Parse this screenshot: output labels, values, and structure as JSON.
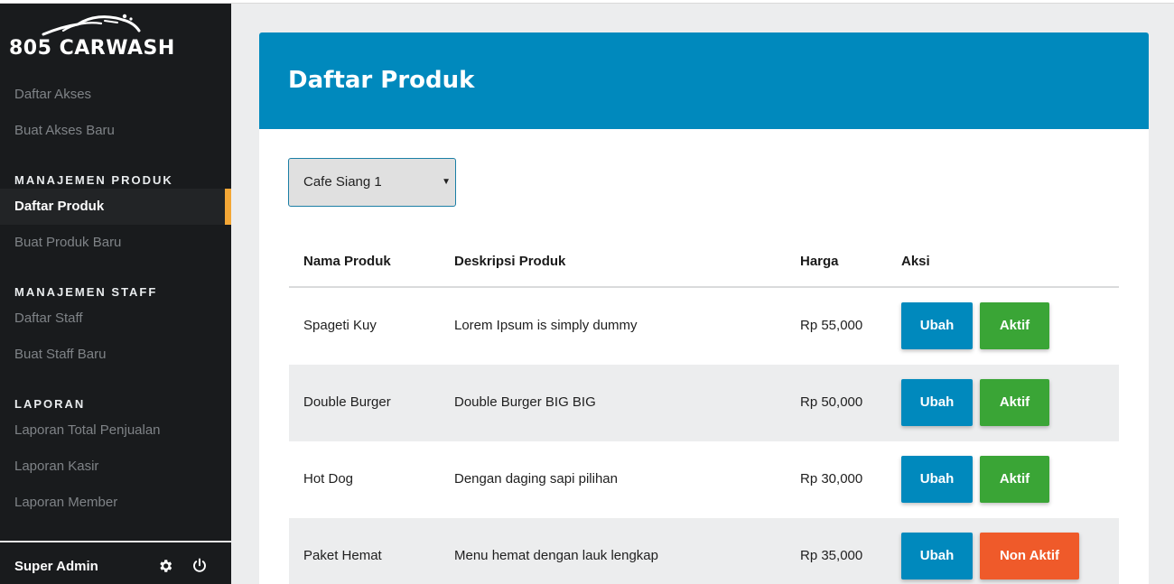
{
  "brand": {
    "name": "805 CARWASH"
  },
  "sidebar": {
    "items_top": [
      {
        "label": "Daftar Akses"
      },
      {
        "label": "Buat Akses Baru"
      }
    ],
    "sections": [
      {
        "title": "MANAJEMEN PRODUK",
        "items": [
          {
            "label": "Daftar Produk",
            "active": true
          },
          {
            "label": "Buat Produk Baru"
          }
        ]
      },
      {
        "title": "MANAJEMEN STAFF",
        "items": [
          {
            "label": "Daftar Staff"
          },
          {
            "label": "Buat Staff Baru"
          }
        ]
      },
      {
        "title": "LAPORAN",
        "items": [
          {
            "label": "Laporan Total Penjualan"
          },
          {
            "label": "Laporan Kasir"
          },
          {
            "label": "Laporan Member"
          }
        ]
      }
    ],
    "footer": {
      "user": "Super Admin",
      "settings_icon": "gear-icon",
      "logout_icon": "power-icon"
    }
  },
  "main": {
    "title": "Daftar Produk",
    "outlet_select": {
      "selected": "Cafe Siang 1"
    },
    "table": {
      "headers": [
        "Nama Produk",
        "Deskripsi Produk",
        "Harga",
        "Aksi"
      ],
      "rows": [
        {
          "name": "Spageti Kuy",
          "description": "Lorem Ipsum is simply dummy",
          "price": "Rp 55,000",
          "edit": "Ubah",
          "status": "Aktif"
        },
        {
          "name": "Double Burger",
          "description": "Double Burger BIG BIG",
          "price": "Rp 50,000",
          "edit": "Ubah",
          "status": "Aktif"
        },
        {
          "name": "Hot Dog",
          "description": "Dengan daging sapi pilihan",
          "price": "Rp 30,000",
          "edit": "Ubah",
          "status": "Aktif"
        },
        {
          "name": "Paket Hemat",
          "description": "Menu hemat dengan lauk lengkap",
          "price": "Rp 35,000",
          "edit": "Ubah",
          "status": "Non Aktif"
        }
      ]
    }
  },
  "colors": {
    "sidebar_bg": "#191b1d",
    "header_bg": "#0089bd",
    "active_marker": "#f4a736",
    "edit_button": "#0089bd",
    "status_active": "#3aa536",
    "status_inactive": "#ef5a2a"
  }
}
